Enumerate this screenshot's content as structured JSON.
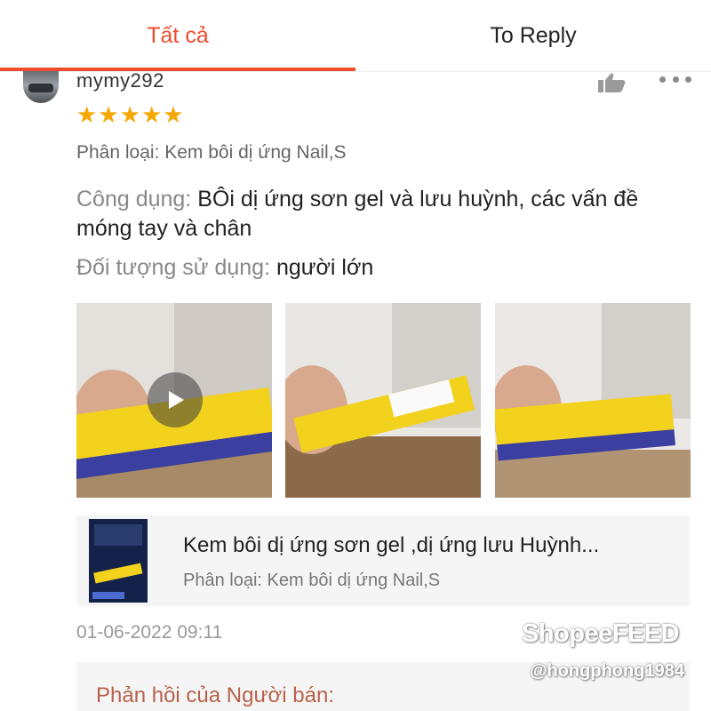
{
  "tabs": [
    {
      "label": "Tất cả",
      "active": true
    },
    {
      "label": "To Reply",
      "active": false
    }
  ],
  "review": {
    "username": "mymy292",
    "rating": 5,
    "stars": [
      "★",
      "★",
      "★",
      "★",
      "★"
    ],
    "variation": "Phân loại: Kem bôi dị ứng Nail,S",
    "usage_key": "Công dụng:",
    "usage_value": "BÔi dị ứng sơn gel và lưu huỳnh, các vấn đề móng tay và chân",
    "target_key": "Đối tượng sử dụng:",
    "target_value": "người lớn",
    "date": "01-06-2022 09:11"
  },
  "product": {
    "title": "Kem bôi dị ứng sơn  gel ,dị ứng lưu Huỳnh...",
    "variation": "Phân loại: Kem bôi dị ứng Nail,S"
  },
  "seller_reply": {
    "label": "Phản hồi của Người bán:"
  },
  "watermark": {
    "brand": "ShopeeFEED",
    "handle": "@hongphong1984"
  },
  "icons": {
    "like": "thumbs-up-icon",
    "more": "more-dots-icon",
    "play": "play-icon"
  },
  "colors": {
    "accent": "#ee4d2d",
    "star": "#f6a700",
    "reply_label": "#b8614a"
  }
}
